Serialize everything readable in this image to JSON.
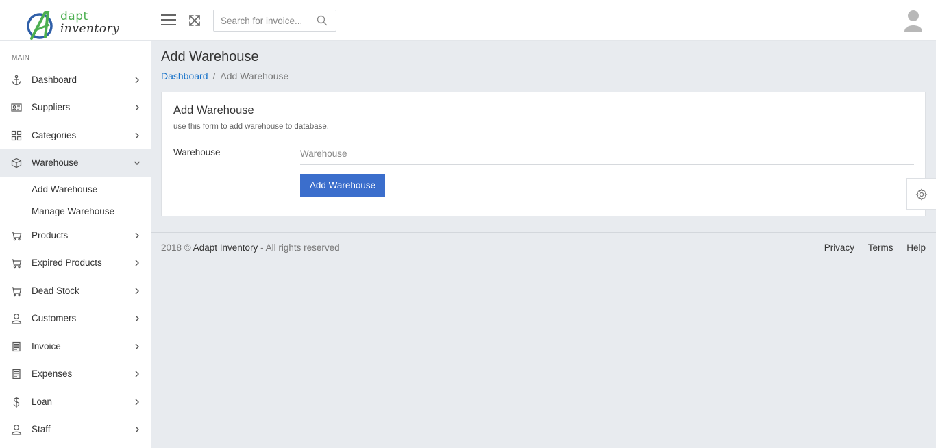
{
  "logo": {
    "line1": "dapt",
    "line2": "inventory"
  },
  "search": {
    "placeholder": "Search for invoice..."
  },
  "sidebar": {
    "section": "MAIN",
    "items": [
      {
        "label": "Dashboard",
        "icon": "anchor-icon"
      },
      {
        "label": "Suppliers",
        "icon": "id-card-icon"
      },
      {
        "label": "Categories",
        "icon": "grid-icon"
      },
      {
        "label": "Warehouse",
        "icon": "box-icon",
        "expanded": true
      },
      {
        "label": "Products",
        "icon": "cart-icon"
      },
      {
        "label": "Expired Products",
        "icon": "cart-icon"
      },
      {
        "label": "Dead Stock",
        "icon": "cart-icon"
      },
      {
        "label": "Customers",
        "icon": "user-icon"
      },
      {
        "label": "Invoice",
        "icon": "receipt-icon"
      },
      {
        "label": "Expenses",
        "icon": "receipt-icon"
      },
      {
        "label": "Loan",
        "icon": "dollar-icon"
      },
      {
        "label": "Staff",
        "icon": "user-icon"
      }
    ],
    "warehouse_sub": [
      "Add Warehouse",
      "Manage Warehouse"
    ]
  },
  "page": {
    "title": "Add Warehouse",
    "breadcrumb": {
      "home": "Dashboard",
      "separator": "/",
      "current": "Add Warehouse"
    }
  },
  "form": {
    "title": "Add Warehouse",
    "subtitle": "use this form to add warehouse to database.",
    "field_label": "Warehouse",
    "field_placeholder": "Warehouse",
    "field_value": "",
    "submit_label": "Add Warehouse"
  },
  "footer": {
    "prefix": "2018 ©",
    "brand": "Adapt Inventory",
    "suffix": "- All rights reserved",
    "links": [
      "Privacy",
      "Terms",
      "Help"
    ]
  },
  "colors": {
    "accent": "#3b6ecc",
    "link": "#1a73c9",
    "logo_green": "#4caf50",
    "background": "#e8ebef"
  }
}
